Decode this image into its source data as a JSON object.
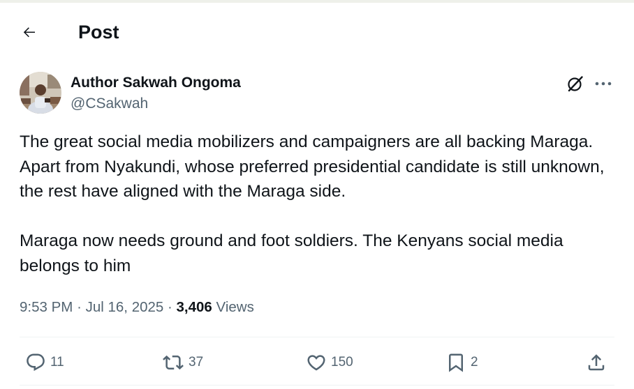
{
  "header": {
    "title": "Post",
    "back_icon": "arrow-left-icon"
  },
  "author": {
    "name": "Author Sakwah Ongoma",
    "handle": "@CSakwah",
    "avatar_icon": "avatar-photo"
  },
  "post": {
    "paragraphs": [
      "The great social media mobilizers and campaigners are all backing Maraga. Apart from Nyakundi, whose preferred presidential candidate is still unknown, the rest have aligned with the Maraga side.",
      "Maraga now needs ground and foot soldiers. The Kenyans social media belongs to him"
    ],
    "time": "9:53 PM",
    "separator": "·",
    "date": "Jul 16, 2025",
    "views_count": "3,406",
    "views_label": "Views"
  },
  "actions": {
    "replies": "11",
    "reposts": "37",
    "likes": "150",
    "bookmarks": "2"
  },
  "colors": {
    "text_primary": "#0f1419",
    "text_secondary": "#536471",
    "divider": "#eff3f4"
  }
}
